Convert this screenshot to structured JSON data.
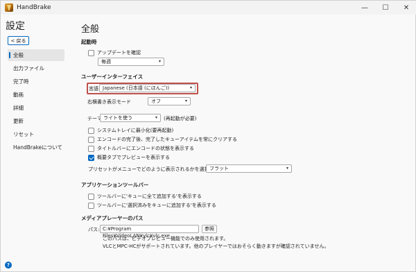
{
  "window": {
    "title": "HandBrake",
    "controls": {
      "minimize": "—",
      "maximize": "☐",
      "close": "✕"
    }
  },
  "sidebar": {
    "title": "設定",
    "back_label": "< 戻る",
    "items": [
      {
        "label": "全般",
        "active": true
      },
      {
        "label": "出力ファイル"
      },
      {
        "label": "完了時"
      },
      {
        "label": "動画"
      },
      {
        "label": "詳細"
      },
      {
        "label": "更新"
      },
      {
        "label": "リセット"
      },
      {
        "label": "HandBrakeについて"
      }
    ],
    "help": "?"
  },
  "main": {
    "title": "全般",
    "startup": {
      "heading": "起動時",
      "check_updates_label": "アップデートを確認",
      "check_updates_checked": false,
      "frequency_value": "毎週"
    },
    "ui": {
      "heading": "ユーザーインターフェイス",
      "language_label": "言語",
      "language_value": "Japanese (日本語 (にほんご))",
      "rtl_label": "右横書き表示モード",
      "rtl_value": "オフ",
      "theme_label": "テーマ",
      "theme_value": "ライトを使う",
      "theme_note": "(再起動が必要)",
      "options": [
        {
          "label": "システムトレイに最小化(要再起動)",
          "checked": false
        },
        {
          "label": "エンコードの完了後、完了したキューアイテムを常にクリアする",
          "checked": false
        },
        {
          "label": "タイトルバーにエンコードの状態を表示する",
          "checked": false
        },
        {
          "label": "概要タブでプレビューを表示する",
          "checked": true
        }
      ],
      "preset_menu_label": "プリセットがメニューでどのように表示されるかを選択:",
      "preset_menu_value": "フラット"
    },
    "toolbar": {
      "heading": "アプリケーションツールバー",
      "options": [
        {
          "label": "ツールバーに'キューに全て追加する'を表示する",
          "checked": false
        },
        {
          "label": "ツールバーに'選択済みをキューに追加する'を表示する",
          "checked": false
        }
      ]
    },
    "media_player": {
      "heading": "メディアプレーヤーのパス",
      "path_label": "パス:",
      "path_value": "C:¥Program Files¥VideoLAN¥vlc¥vlc.exe",
      "browse_label": "参照",
      "note1": "このパスは、ビデオプレビュー機能でのみ使用されます。",
      "note2": "VLCとMPC-HCがサポートされています。他のプレイヤーではおそらく動きますが確認されていません。"
    }
  }
}
